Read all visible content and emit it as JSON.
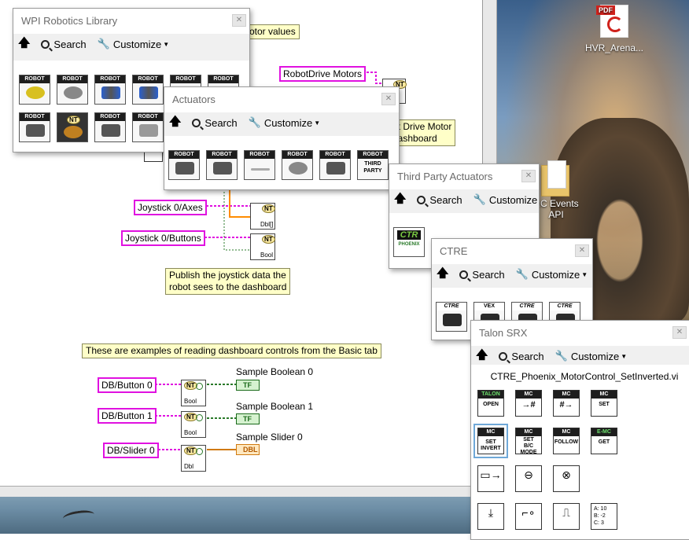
{
  "desktop": {
    "icons": [
      {
        "name": "pdf-file",
        "badge": "PDF",
        "label": "HVR_Arena..."
      },
      {
        "name": "folder",
        "label": "RC Events API"
      }
    ]
  },
  "diagram": {
    "comments": {
      "motor_values": "otor values",
      "robot_drive_dashboard": "ot Drive Motor\ndashboard",
      "publish_joystick": "Publish the joystick data the\nrobot sees to the dashboard",
      "examples_dashboard": "These are examples of reading dashboard controls from the Basic tab"
    },
    "string_constants": {
      "robotdrive_motors": "RobotDrive Motors",
      "joystick_axes": "Joystick 0/Axes",
      "joystick_buttons": "Joystick 0/Buttons",
      "db_button0": "DB/Button 0",
      "db_button1": "DB/Button 1",
      "db_slider0": "DB/Slider 0"
    },
    "nt_nodes": {
      "badge": "NT",
      "dbl_array": "Dbl[]",
      "bool": "Bool",
      "dbl": "Dbl"
    },
    "indicators": {
      "sample_boolean0": {
        "label": "Sample Boolean 0",
        "type": "TF"
      },
      "sample_boolean1": {
        "label": "Sample Boolean 1",
        "type": "TF"
      },
      "sample_slider0": {
        "label": "Sample Slider 0",
        "type": "DBL"
      }
    }
  },
  "palettes": {
    "wpi": {
      "title": "WPI Robotics Library",
      "search": "Search",
      "customize": "Customize",
      "icon_header": "ROBOT",
      "nt_badge": "NT"
    },
    "actuators": {
      "title": "Actuators",
      "search": "Search",
      "customize": "Customize",
      "icon_header": "ROBOT",
      "third_party": "THIRD\nPARTY"
    },
    "third_party": {
      "title": "Third Party Actuators",
      "search": "Search",
      "customize": "Customize",
      "ctr_logo": "CTR",
      "phoenix": "PHOENIX"
    },
    "ctre": {
      "title": "CTRE",
      "search": "Search",
      "customize": "Customize",
      "headers": [
        "CTRE",
        "VEX",
        "CTRE",
        "CTRE"
      ]
    },
    "talon": {
      "title": "Talon SRX",
      "search": "Search",
      "customize": "Customize",
      "vi_name": "CTRE_Phoenix_MotorControl_SetInverted.vi",
      "row1": [
        {
          "hdr": "TALON",
          "label": "OPEN",
          "green": true
        },
        {
          "hdr": "MC",
          "label": "→#",
          "green": false
        },
        {
          "hdr": "MC",
          "label": "#→",
          "green": false
        },
        {
          "hdr": "MC",
          "label": "SET",
          "green": false
        }
      ],
      "row2": [
        {
          "hdr": "MC",
          "label": "SET\nINVERT",
          "green": false
        },
        {
          "hdr": "MC",
          "label": "SET\nB/C\nMODE",
          "green": false
        },
        {
          "hdr": "MC",
          "label": "FOLLOW",
          "green": false
        },
        {
          "hdr": "E-MC",
          "label": "GET",
          "green": true
        }
      ],
      "row4_enum": "A: 10\nB: -2\nC: 3"
    }
  }
}
